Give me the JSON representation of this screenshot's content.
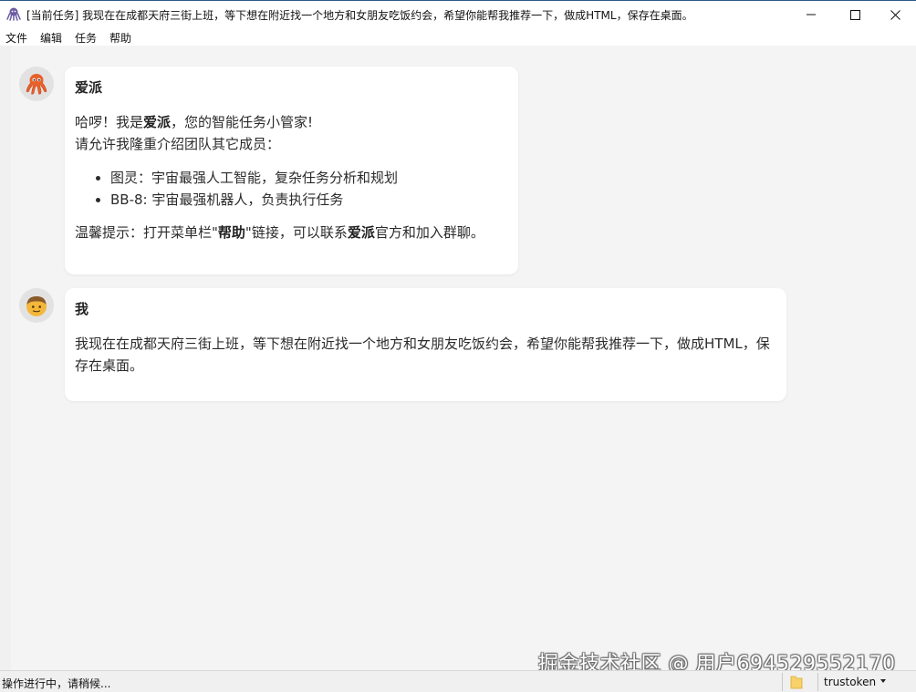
{
  "window": {
    "title": "[当前任务] 我现在在成都天府三街上班，等下想在附近找一个地方和女朋友吃饭约会，希望你能帮我推荐一下，做成HTML，保存在桌面。",
    "app_icon": "octopus-icon"
  },
  "menu": {
    "file": "文件",
    "edit": "编辑",
    "task": "任务",
    "help": "帮助"
  },
  "messages": {
    "assistant": {
      "avatar": "octopus-icon",
      "sender": "爱派",
      "line1_pre": "哈啰！我是",
      "line1_name": "爱派",
      "line1_post": "，您的智能任务小管家!",
      "line2": "请允许我隆重介绍团队其它成员：",
      "members": [
        "图灵：宇宙最强人工智能，复杂任务分析和规划",
        "BB-8: 宇宙最强机器人，负责执行任务"
      ],
      "tip_pre": "温馨提示：打开菜单栏\"",
      "tip_link": "帮助",
      "tip_mid": "\"链接，可以联系",
      "tip_name": "爱派",
      "tip_post": "官方和加入群聊。"
    },
    "user": {
      "avatar": "person-face-icon",
      "sender": "我",
      "text": "我现在在成都天府三街上班，等下想在附近找一个地方和女朋友吃饭约会，希望你能帮我推荐一下，做成HTML，保存在桌面。"
    }
  },
  "watermark": "掘金技术社区 @ 用户694529552170",
  "status": {
    "text": "操作进行中，请稍候...",
    "folder_icon": "folder-icon",
    "token": "trustoken"
  },
  "colors": {
    "chat_background": "#f4f4f4",
    "bubble_background": "#ffffff",
    "octopus": "#e8602c",
    "face": "#f4b73a"
  }
}
